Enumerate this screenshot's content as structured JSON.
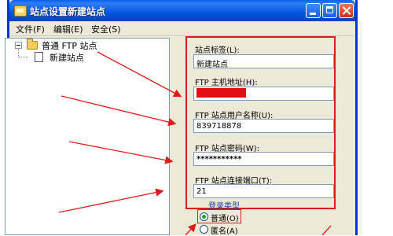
{
  "window": {
    "title": "站点设置新建站点"
  },
  "menu": [
    {
      "label": "文件(F)"
    },
    {
      "label": "编辑(E)"
    },
    {
      "label": "安全(S)"
    }
  ],
  "tree": {
    "root_label": "普通 FTP 站点",
    "child_label": "新建站点"
  },
  "form": {
    "site_label": "站点标签(L):",
    "site_value": "新建站点",
    "host_label": "FTP 主机地址(H):",
    "user_label": "FTP 站点用户名称(U):",
    "user_value": "839718878",
    "password_label": "FTP 站点密码(W):",
    "password_value": "***********",
    "port_label": "FTP 站点连接端口(T):",
    "port_value": "21"
  },
  "login": {
    "type_label": "登录类型",
    "options": [
      {
        "label": "普通(O)",
        "selected": true
      },
      {
        "label": "匿名(A)",
        "selected": false
      }
    ]
  },
  "colors": {
    "annotation_red": "#e01b1b",
    "titlebar_blue": "#0457e0"
  }
}
